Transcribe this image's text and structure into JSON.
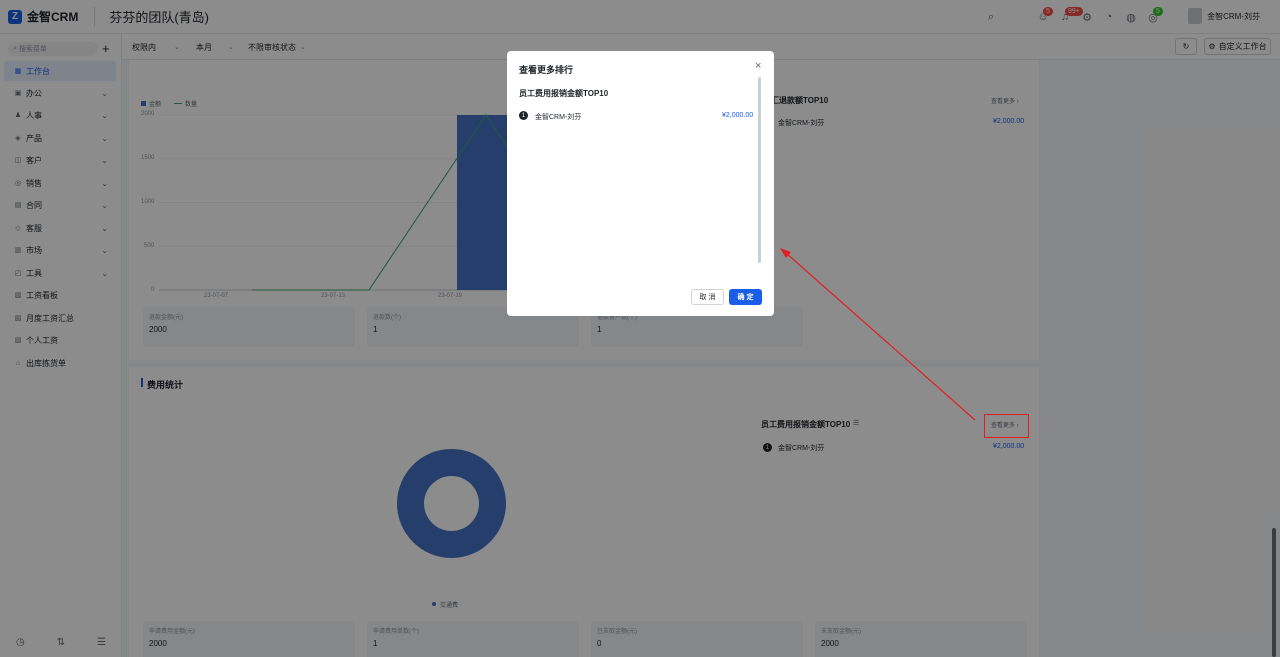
{
  "topbar": {
    "logo_mark": "Z",
    "logo_text": "金智CRM",
    "team_name": "芬芬的团队(青岛)",
    "badges": {
      "contacts": "5",
      "notifications": "99+",
      "apps": "5"
    },
    "user_name": "金智CRM-刘芬"
  },
  "sidebar": {
    "search_placeholder": "搜索菜单",
    "add": "+",
    "items": [
      {
        "label": "工作台",
        "icon": "▦"
      },
      {
        "label": "办公",
        "icon": "▣"
      },
      {
        "label": "人事",
        "icon": "♟"
      },
      {
        "label": "产品",
        "icon": "◈"
      },
      {
        "label": "客户",
        "icon": "◫"
      },
      {
        "label": "销售",
        "icon": "◎"
      },
      {
        "label": "合同",
        "icon": "▤"
      },
      {
        "label": "客服",
        "icon": "◇"
      },
      {
        "label": "市场",
        "icon": "▥"
      },
      {
        "label": "工具",
        "icon": "◰"
      },
      {
        "label": "工资看板",
        "icon": "▧"
      },
      {
        "label": "月度工资汇总",
        "icon": "▧"
      },
      {
        "label": "个人工资",
        "icon": "▧"
      },
      {
        "label": "出库拣货单",
        "icon": "⌂"
      }
    ],
    "bottom": [
      "◷",
      "⇅",
      "☰"
    ]
  },
  "filters": {
    "scope": "权限内",
    "period": "本月",
    "status": "不限审核状态",
    "refresh": "↻",
    "customize": "自定义工作台"
  },
  "top_section": {
    "legend": [
      "金额",
      "数量"
    ],
    "y_ticks": [
      "2000",
      "1500",
      "1000",
      "500",
      "0"
    ],
    "x_ticks": [
      "23-07-07",
      "23-07-13",
      "23-07-19"
    ],
    "stats": [
      {
        "label": "退款金额(元)",
        "value": "2000"
      },
      {
        "label": "退款数(个)",
        "value": "1"
      },
      {
        "label": "退款客户数(个)",
        "value": "1"
      }
    ],
    "rank_title": "汇退款额TOP10",
    "more": "查看更多 ›",
    "rank": [
      {
        "no": "1",
        "name": "金智CRM-刘芬",
        "value": "¥2,000.00"
      }
    ]
  },
  "expense_section": {
    "title": "费用统计",
    "rank_title": "员工费用报销金额TOP10",
    "more": "查看更多 ›",
    "rank": [
      {
        "no": "1",
        "name": "金智CRM-刘芬",
        "value": "¥2,000.00"
      }
    ],
    "donut_legend": "交通费",
    "stats": [
      {
        "label": "申请费用金额(元)",
        "value": "2000"
      },
      {
        "label": "申请费用单数(个)",
        "value": "1"
      },
      {
        "label": "已支取金额(元)",
        "value": "0"
      },
      {
        "label": "未支取金额(元)",
        "value": "2000"
      }
    ]
  },
  "modal": {
    "title": "查看更多排行",
    "close": "×",
    "subtitle": "员工费用报销金额TOP10",
    "rank": [
      {
        "no": "1",
        "name": "金智CRM-刘芬",
        "value": "¥2,000.00"
      }
    ],
    "cancel": "取 消",
    "ok": "确 定"
  },
  "chart_data": {
    "type": "bar",
    "categories": [
      "23-07-07",
      "23-07-13",
      "23-07-19"
    ],
    "series": [
      {
        "name": "金额",
        "type": "bar",
        "values": [
          0,
          0,
          2000
        ]
      },
      {
        "name": "数量",
        "type": "line",
        "values": [
          0,
          0,
          1
        ]
      }
    ],
    "ylim": [
      0,
      2000
    ],
    "legend": "top-left",
    "colors": {
      "bar": "#4472c4",
      "line": "#3ba272"
    }
  }
}
